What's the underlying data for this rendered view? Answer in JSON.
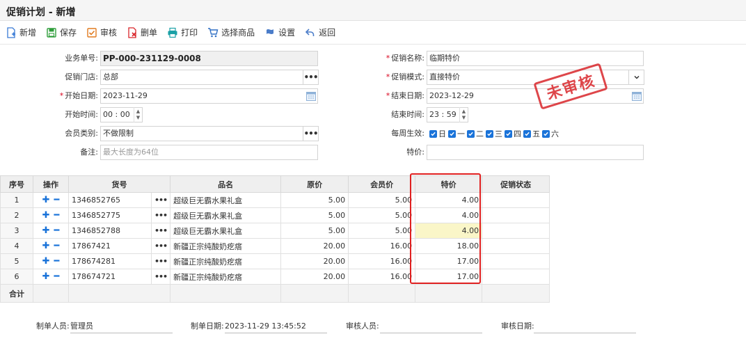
{
  "title": "促销计划 - 新增",
  "toolbar": {
    "new": "新增",
    "save": "保存",
    "audit": "审核",
    "delete": "删单",
    "print": "打印",
    "select_goods": "选择商品",
    "settings": "设置",
    "back": "返回"
  },
  "form": {
    "order_no_label": "业务单号:",
    "order_no": "PP-000-231129-0008",
    "store_label": "促销门店:",
    "store": "总部",
    "start_date_label": "开始日期:",
    "start_date": "2023-11-29",
    "start_time_label": "开始时间:",
    "start_time": "00 : 00",
    "member_type_label": "会员类别:",
    "member_type": "不做限制",
    "remark_label": "备注:",
    "remark_placeholder": "最大长度为64位",
    "promo_name_label": "促销名称:",
    "promo_name": "临期特价",
    "promo_mode_label": "促销模式:",
    "promo_mode": "直接特价",
    "end_date_label": "结束日期:",
    "end_date": "2023-12-29",
    "end_time_label": "结束时间:",
    "end_time": "23 : 59",
    "weekly_label": "每周生效:",
    "weekdays": [
      "日",
      "一",
      "二",
      "三",
      "四",
      "五",
      "六"
    ],
    "special_price_label": "特价:",
    "special_price": ""
  },
  "stamp": "未审核",
  "grid": {
    "headers": {
      "idx": "序号",
      "ops": "操作",
      "code": "货号",
      "name": "品名",
      "orig": "原价",
      "member": "会员价",
      "special": "特价",
      "status": "促销状态"
    },
    "rows": [
      {
        "idx": "1",
        "code": "1346852765",
        "name": "超级巨无霸水果礼盒",
        "orig": "5.00",
        "member": "5.00",
        "special": "4.00",
        "status": ""
      },
      {
        "idx": "2",
        "code": "1346852775",
        "name": "超级巨无霸水果礼盒",
        "orig": "5.00",
        "member": "5.00",
        "special": "4.00",
        "status": ""
      },
      {
        "idx": "3",
        "code": "1346852788",
        "name": "超级巨无霸水果礼盒",
        "orig": "5.00",
        "member": "5.00",
        "special": "4.00",
        "status": ""
      },
      {
        "idx": "4",
        "code": "17867421",
        "name": "新疆正宗纯酸奶疙瘩",
        "orig": "20.00",
        "member": "16.00",
        "special": "18.00",
        "status": ""
      },
      {
        "idx": "5",
        "code": "178674281",
        "name": "新疆正宗纯酸奶疙瘩",
        "orig": "20.00",
        "member": "16.00",
        "special": "17.00",
        "status": ""
      },
      {
        "idx": "6",
        "code": "178674721",
        "name": "新疆正宗纯酸奶疙瘩",
        "orig": "20.00",
        "member": "16.00",
        "special": "17.00",
        "status": ""
      }
    ],
    "total_label": "合计"
  },
  "footer": {
    "maker_label": "制单人员:",
    "maker": "管理员",
    "make_date_label": "制单日期:",
    "make_date": "2023-11-29 13:45:52",
    "auditor_label": "审核人员:",
    "auditor": "",
    "audit_date_label": "审核日期:",
    "audit_date": ""
  },
  "colors": {
    "accent": "#1a73d9",
    "highlight_frame": "#e02020",
    "stamp": "#d9262b",
    "edited_cell": "#faf6c8"
  }
}
